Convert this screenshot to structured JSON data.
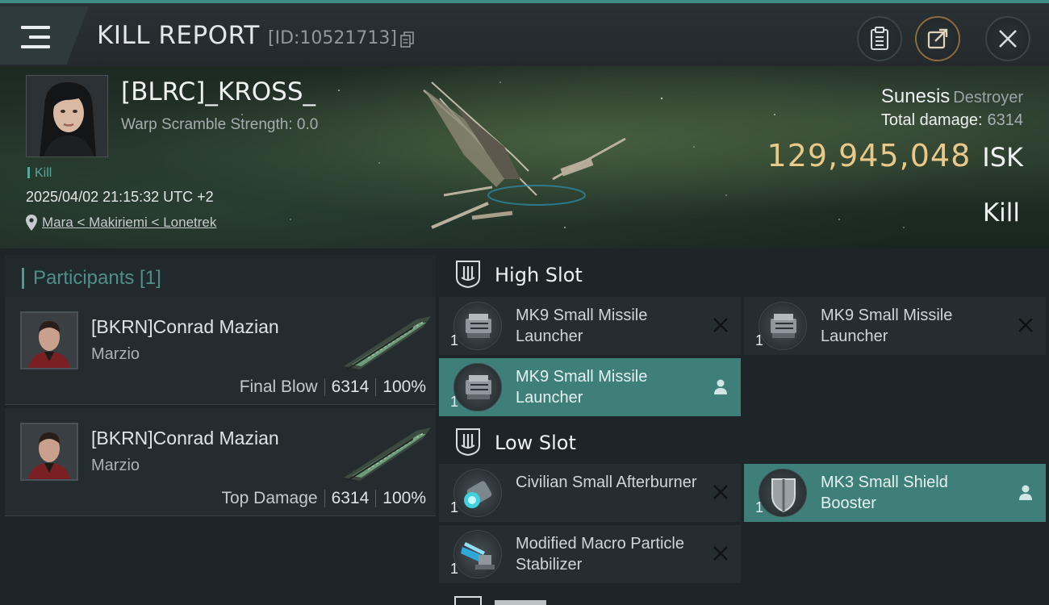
{
  "header": {
    "title": "KILL REPORT",
    "report_id": "[ID:10521713]"
  },
  "victim": {
    "name": "[BLRC]_KROSS_",
    "warp_scramble": "Warp Scramble Strength: 0.0",
    "kill_tag": "Kill",
    "datetime": "2025/04/02 21:15:32 UTC +2",
    "location": "Mara < Makiriemi < Lonetrek",
    "ship_name": "Sunesis",
    "ship_class": "Destroyer",
    "total_damage_label": "Total damage:",
    "total_damage": "6314",
    "isk_value": "129,945,048",
    "isk_unit": "ISK",
    "result": "Kill"
  },
  "participants": {
    "title": "Participants [1]",
    "items": [
      {
        "name": "[BKRN]Conrad Mazian",
        "corp": "Marzio",
        "role": "Final Blow",
        "damage": "6314",
        "percent": "100%"
      },
      {
        "name": "[BKRN]Conrad Mazian",
        "corp": "Marzio",
        "role": "Top Damage",
        "damage": "6314",
        "percent": "100%"
      }
    ]
  },
  "fitting": {
    "high_slot": {
      "title": "High Slot",
      "modules": [
        {
          "name": "MK9 Small Missile Launcher",
          "qty": "1",
          "state": "destroyed",
          "icon": "missile-launcher-icon"
        },
        {
          "name": "MK9 Small Missile Launcher",
          "qty": "1",
          "state": "destroyed",
          "icon": "missile-launcher-icon"
        },
        {
          "name": "MK9 Small Missile Launcher",
          "qty": "1",
          "state": "dropped",
          "icon": "missile-launcher-icon"
        }
      ]
    },
    "low_slot": {
      "title": "Low Slot",
      "modules": [
        {
          "name": "Civilian Small Afterburner",
          "qty": "1",
          "state": "destroyed",
          "icon": "afterburner-icon"
        },
        {
          "name": "MK3 Small Shield Booster",
          "qty": "1",
          "state": "dropped",
          "icon": "shield-booster-icon"
        },
        {
          "name": "Modified Macro Particle Stabilizer",
          "qty": "1",
          "state": "destroyed",
          "icon": "particle-stabilizer-icon"
        }
      ]
    }
  },
  "colors": {
    "accent": "#3f7f7a",
    "isk": "#e8c98a",
    "highlight_row": "#3f7f7a"
  }
}
